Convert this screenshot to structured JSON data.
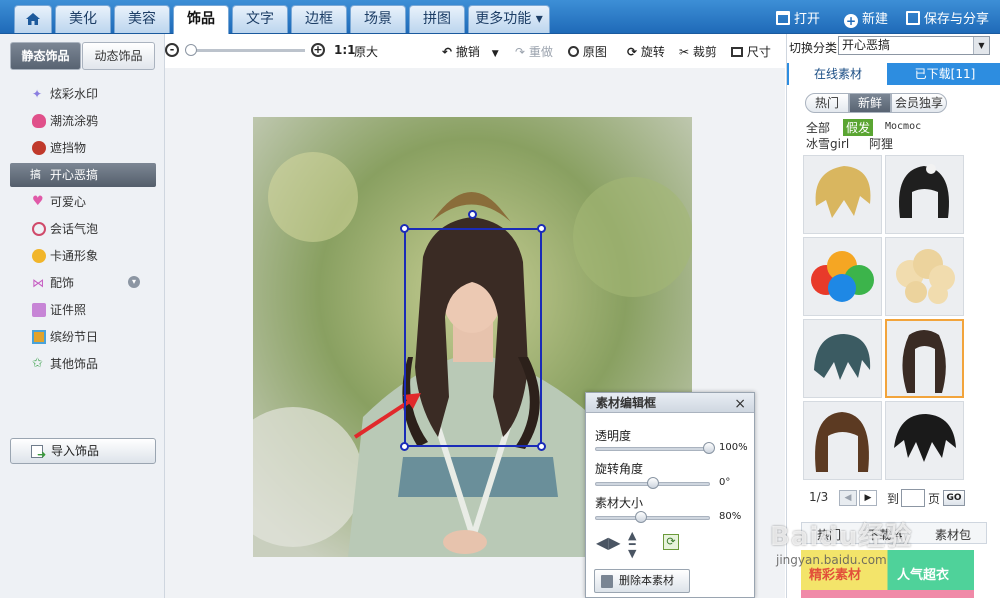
{
  "topnav": {
    "tabs": [
      "美化",
      "美容",
      "饰品",
      "文字",
      "边框",
      "场景",
      "拼图",
      "更多功能 ▾"
    ],
    "active_index": 2,
    "actions": {
      "open": "打开",
      "new": "新建",
      "save": "保存与分享"
    }
  },
  "left": {
    "tabs": [
      "静态饰品",
      "动态饰品"
    ],
    "items": [
      "炫彩水印",
      "潮流涂鸦",
      "遮挡物",
      "开心恶搞",
      "可爱心",
      "会话气泡",
      "卡通形象",
      "配饰",
      "证件照",
      "缤纷节日",
      "其他饰品"
    ],
    "active_index": 3,
    "import_label": "导入饰品"
  },
  "toolbar": {
    "ratio_label": "1:1",
    "original_size": "原大",
    "undo": "撤销",
    "redo": "重做",
    "original": "原图",
    "rotate": "旋转",
    "crop": "裁剪",
    "size": "尺寸"
  },
  "editor": {
    "title": "素材编辑框",
    "opacity_label": "透明度",
    "opacity_value": "100%",
    "opacity_level": 1.0,
    "rotation_label": "旋转角度",
    "rotation_value": "0°",
    "rotation_level": 0.5,
    "scale_label": "素材大小",
    "scale_value": "80%",
    "scale_level": 0.4,
    "delete_label": "删除本素材"
  },
  "right": {
    "switch_label": "切换分类",
    "switch_value": "开心恶搞",
    "tabs": [
      "在线素材",
      "已下载[11]"
    ],
    "pills": [
      "热门",
      "新鲜",
      "会员独享"
    ],
    "active_pill": 1,
    "categories": [
      "全部",
      "假发",
      "Mocmoc",
      "冰雪girl",
      "阿狸"
    ],
    "active_category": 1,
    "pager": {
      "page": "1/3",
      "goto": "到",
      "unit": "页",
      "go": "GO"
    },
    "bottom": {
      "label1": "热门",
      "label2": "下载 4",
      "label3": "素材包"
    },
    "banner": {
      "left": "精彩素材",
      "right": "人气超衣"
    }
  },
  "watermark": {
    "text": "Baidu经验",
    "url": "jingyan.baidu.com"
  }
}
